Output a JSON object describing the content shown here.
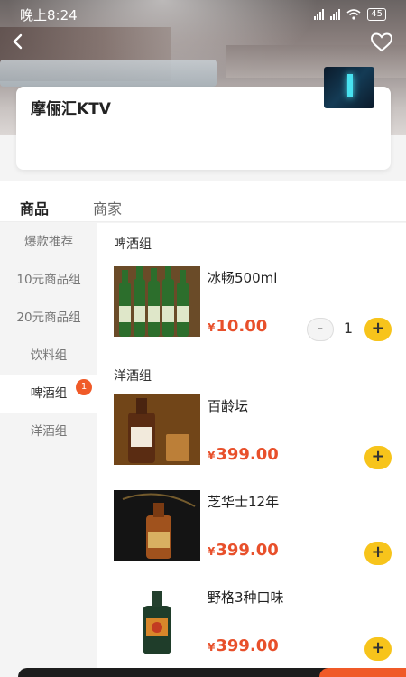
{
  "status_bar": {
    "time": "晚上8:24",
    "battery": "45"
  },
  "store": {
    "name": "摩俪汇KTV"
  },
  "tabs": [
    {
      "label": "商品",
      "active": true
    },
    {
      "label": "商家",
      "active": false
    }
  ],
  "categories": [
    {
      "label": "爆款推荐"
    },
    {
      "label": "10元商品组"
    },
    {
      "label": "20元商品组"
    },
    {
      "label": "饮料组"
    },
    {
      "label": "啤酒组",
      "active": true,
      "badge": "1"
    },
    {
      "label": "洋酒组"
    }
  ],
  "groups": [
    {
      "title": "啤酒组",
      "products": [
        {
          "name": "冰畅500ml",
          "currency": "¥",
          "price": "10.00",
          "quantity": "1",
          "image_icon": "beer-bottles-image"
        }
      ]
    },
    {
      "title": "洋酒组",
      "products": [
        {
          "name": "百龄坛",
          "currency": "¥",
          "price": "399.00",
          "image_icon": "whisky-bottle-image"
        },
        {
          "name": "芝华士12年",
          "currency": "¥",
          "price": "399.00",
          "image_icon": "chivas-bottle-image"
        },
        {
          "name": "野格3种口味",
          "currency": "¥",
          "price": "399.00",
          "image_icon": "jagermeister-bottle-image"
        }
      ]
    }
  ],
  "buttons": {
    "add": "+",
    "minus": "-"
  },
  "colors": {
    "accent": "#e8502b",
    "add_button": "#f7c41b",
    "badge": "#f05a28"
  }
}
